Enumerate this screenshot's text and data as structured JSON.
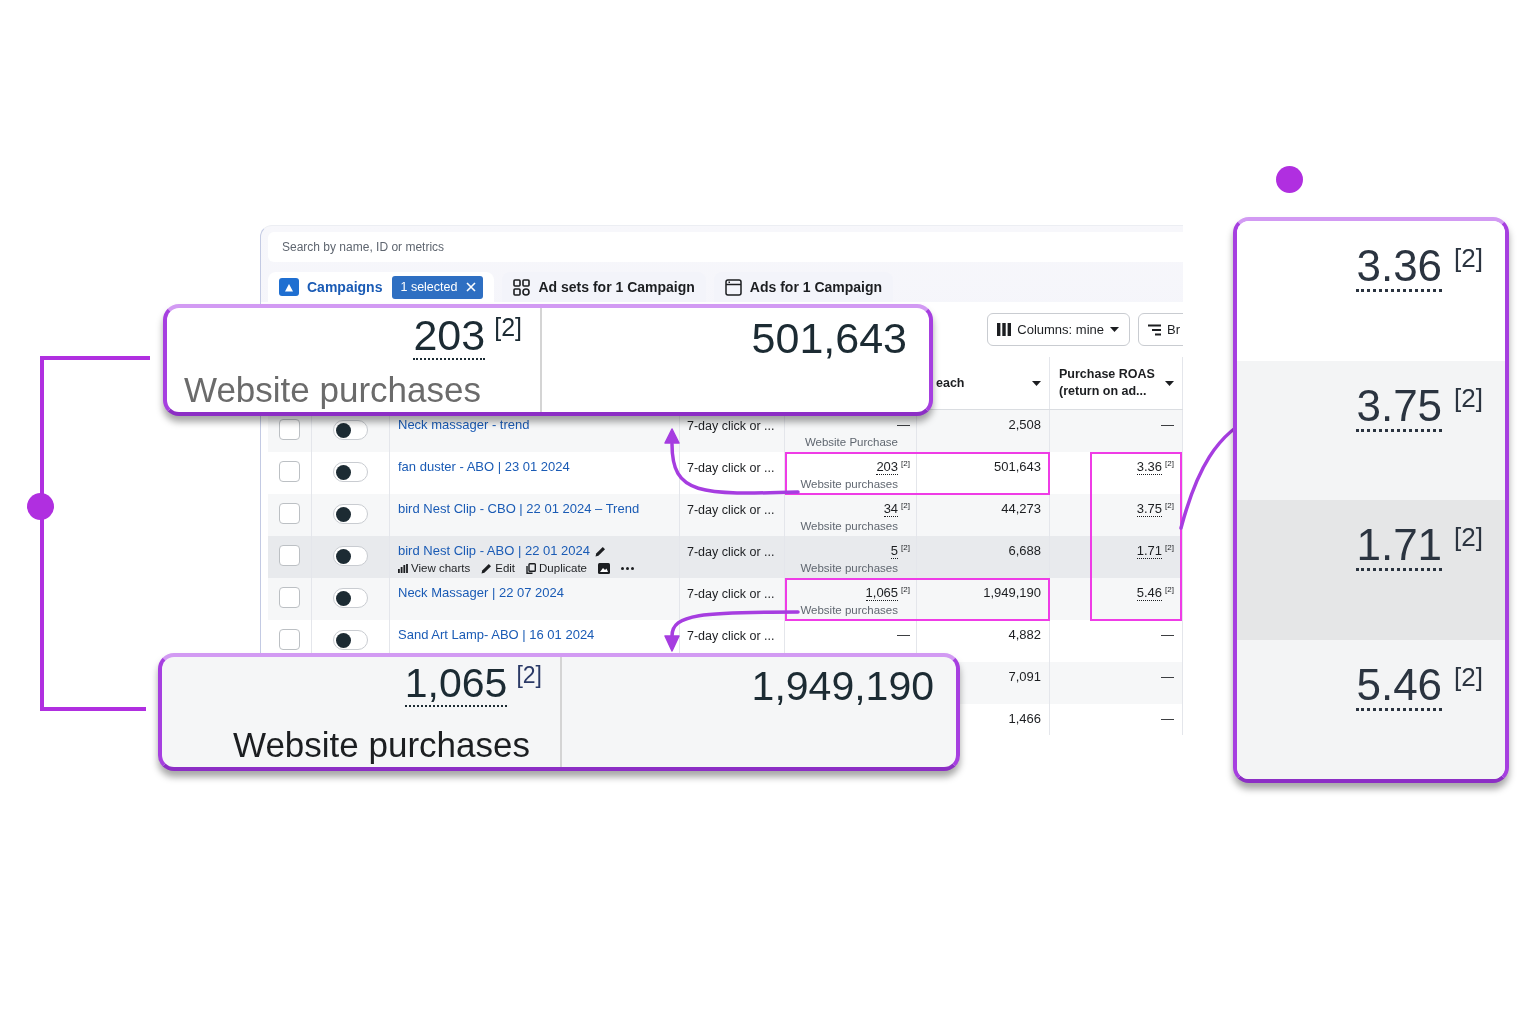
{
  "search": {
    "placeholder": "Search by name, ID or metrics"
  },
  "tabs": [
    {
      "kind": "campaigns",
      "label": "Campaigns",
      "selected": true,
      "badge": "1 selected"
    },
    {
      "kind": "ad_sets",
      "label": "Ad sets for 1 Campaign",
      "selected": false
    },
    {
      "kind": "ads",
      "label": "Ads for 1 Campaign",
      "selected": false
    }
  ],
  "toolbar": [
    {
      "kind": "columns",
      "label": "Columns: mine"
    },
    {
      "kind": "breakdown",
      "label": "Br"
    }
  ],
  "table": {
    "headers": [
      {
        "kind": "reach",
        "label": "each"
      },
      {
        "kind": "roas",
        "label": "Purchase ROAS (return on ad..."
      }
    ],
    "rows": [
      {
        "checked": false,
        "on": false,
        "hovered": false,
        "name": "Neck massager - trend",
        "attribution": "7-day click or ...",
        "result": "—",
        "result_label": "Website Purchase",
        "reach": "2,508",
        "roas": "—"
      },
      {
        "checked": false,
        "on": false,
        "hovered": false,
        "name": "fan duster - ABO | 23 01 2024",
        "attribution": "7-day click or ...",
        "result": "203",
        "result_note": "[2]",
        "result_label": "Website purchases",
        "reach": "501,643",
        "roas": "3.36",
        "roas_note": "[2]"
      },
      {
        "checked": false,
        "on": false,
        "hovered": false,
        "name": "bird Nest Clip - CBO | 22 01 2024 – Trend",
        "attribution": "7-day click or ...",
        "result": "34",
        "result_note": "[2]",
        "result_label": "Website purchases",
        "reach": "44,273",
        "roas": "3.75",
        "roas_note": "[2]"
      },
      {
        "checked": false,
        "on": false,
        "hovered": true,
        "name": "bird Nest Clip - ABO | 22 01 2024",
        "actions": [
          {
            "kind": "charts",
            "label": "View charts"
          },
          {
            "kind": "edit",
            "label": "Edit"
          },
          {
            "kind": "duplicate",
            "label": "Duplicate"
          },
          {
            "kind": "image"
          },
          {
            "kind": "more"
          }
        ],
        "attribution": "7-day click or ...",
        "result": "5",
        "result_note": "[2]",
        "result_label": "Website purchases",
        "reach": "6,688",
        "roas": "1.71",
        "roas_note": "[2]"
      },
      {
        "checked": false,
        "on": false,
        "hovered": false,
        "name": "Neck Massager | 22 07 2024",
        "attribution": "7-day click or ...",
        "result": "1,065",
        "result_note": "[2]",
        "result_label": "Website purchases",
        "reach": "1,949,190",
        "roas": "5.46",
        "roas_note": "[2]"
      },
      {
        "checked": false,
        "on": false,
        "hovered": false,
        "name": "Sand Art Lamp- ABO | 16 01 2024",
        "attribution": "7-day click or ...",
        "result": "—",
        "reach": "4,882",
        "roas": "—"
      },
      {
        "hovered": false,
        "reach": "7,091",
        "roas": "—"
      },
      {
        "hovered": false,
        "reach": "1,466",
        "roas": "—"
      }
    ]
  },
  "callouts": [
    {
      "kind": "plain",
      "result": "203",
      "note": "[2]",
      "label": "Website purchases",
      "reach": "501,643"
    },
    {
      "kind": "striped",
      "result": "1,065",
      "note": "[2]",
      "label": "Website purchases",
      "reach": "1,949,190"
    }
  ],
  "roas_callout": [
    {
      "value": "3.36",
      "note": "[2]",
      "hovered": false
    },
    {
      "value": "3.75",
      "note": "[2]",
      "hovered": false
    },
    {
      "value": "1.71",
      "note": "[2]",
      "hovered": true
    },
    {
      "value": "5.46",
      "note": "[2]",
      "hovered": false
    }
  ]
}
